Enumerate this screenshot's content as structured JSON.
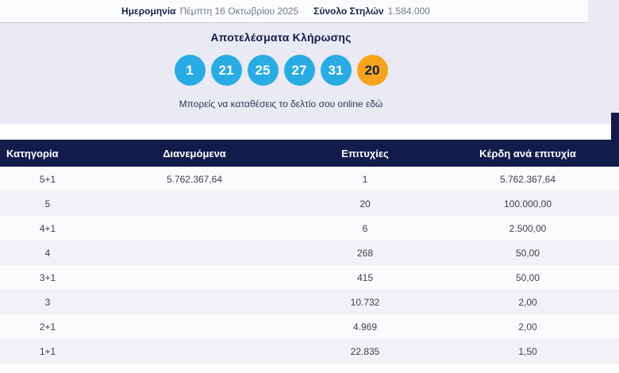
{
  "top_bar": {
    "date_label": "Ημερομηνία",
    "date_value": "Πέμπτη 16 Οκτωβρίου 2025",
    "columns_label": "Σύνολο Στηλών",
    "columns_value": "1.584.000"
  },
  "results": {
    "title": "Αποτελέσματα Κλήρωσης",
    "numbers": [
      {
        "value": "1",
        "type": "main"
      },
      {
        "value": "21",
        "type": "main"
      },
      {
        "value": "25",
        "type": "main"
      },
      {
        "value": "27",
        "type": "main"
      },
      {
        "value": "31",
        "type": "main"
      },
      {
        "value": "20",
        "type": "joker"
      }
    ],
    "cta_text": "Μπορείς να καταθέσεις το δελτίο σου online εδώ"
  },
  "table": {
    "headers": [
      "Κατηγορία",
      "Διανεμόμενα",
      "Επιτυχίες",
      "Κέρδη ανά επιτυχία"
    ],
    "rows": [
      {
        "category": "5+1",
        "distributed": "5.762.367,64",
        "winners": "1",
        "prize": "5.762.367,64"
      },
      {
        "category": "5",
        "distributed": "",
        "winners": "20",
        "prize": "100.000,00"
      },
      {
        "category": "4+1",
        "distributed": "",
        "winners": "6",
        "prize": "2.500,00"
      },
      {
        "category": "4",
        "distributed": "",
        "winners": "268",
        "prize": "50,00"
      },
      {
        "category": "3+1",
        "distributed": "",
        "winners": "415",
        "prize": "50,00"
      },
      {
        "category": "3",
        "distributed": "",
        "winners": "10.732",
        "prize": "2,00"
      },
      {
        "category": "2+1",
        "distributed": "",
        "winners": "4.969",
        "prize": "2,00"
      },
      {
        "category": "1+1",
        "distributed": "",
        "winners": "22.835",
        "prize": "1,50"
      }
    ]
  },
  "colors": {
    "accent_navy": "#131b4c",
    "ball_blue": "#29ace3",
    "ball_orange": "#f6a41c",
    "panel_lavender": "#e9eaf3"
  }
}
